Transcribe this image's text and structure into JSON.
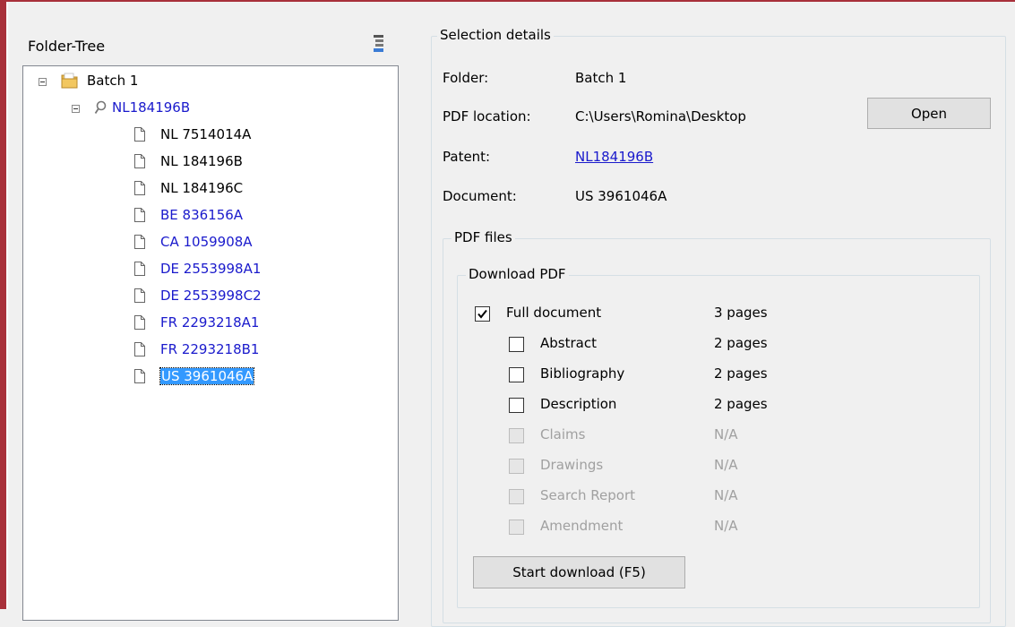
{
  "tree": {
    "title": "Folder-Tree",
    "root": {
      "label": "Batch 1",
      "expanded": true
    },
    "patent": {
      "label": "NL184196B",
      "expanded": true
    },
    "documents": [
      {
        "label": "NL 7514014A",
        "link": false,
        "selected": false
      },
      {
        "label": "NL 184196B",
        "link": false,
        "selected": false
      },
      {
        "label": "NL 184196C",
        "link": false,
        "selected": false
      },
      {
        "label": "BE 836156A",
        "link": true,
        "selected": false
      },
      {
        "label": "CA 1059908A",
        "link": true,
        "selected": false
      },
      {
        "label": "DE 2553998A1",
        "link": true,
        "selected": false
      },
      {
        "label": "DE 2553998C2",
        "link": true,
        "selected": false
      },
      {
        "label": "FR 2293218A1",
        "link": true,
        "selected": false
      },
      {
        "label": "FR 2293218B1",
        "link": true,
        "selected": false
      },
      {
        "label": "US 3961046A",
        "link": true,
        "selected": true
      }
    ]
  },
  "details": {
    "title": "Selection details",
    "folder_label": "Folder:",
    "folder_value": "Batch 1",
    "pdf_location_label": "PDF location:",
    "pdf_location_value": "C:\\Users\\Romina\\Desktop",
    "open_button": "Open",
    "patent_label": "Patent:",
    "patent_value": "NL184196B",
    "document_label": "Document:",
    "document_value": "US 3961046A"
  },
  "pdf_files": {
    "title": "PDF files",
    "download_group_title": "Download PDF",
    "options": [
      {
        "label": "Full document",
        "pages": "3 pages",
        "checked": true,
        "enabled": true
      },
      {
        "label": "Abstract",
        "pages": "2 pages",
        "checked": false,
        "enabled": true
      },
      {
        "label": "Bibliography",
        "pages": "2 pages",
        "checked": false,
        "enabled": true
      },
      {
        "label": "Description",
        "pages": "2 pages",
        "checked": false,
        "enabled": true
      },
      {
        "label": "Claims",
        "pages": "N/A",
        "checked": false,
        "enabled": false
      },
      {
        "label": "Drawings",
        "pages": "N/A",
        "checked": false,
        "enabled": false
      },
      {
        "label": "Search Report",
        "pages": "N/A",
        "checked": false,
        "enabled": false
      },
      {
        "label": "Amendment",
        "pages": "N/A",
        "checked": false,
        "enabled": false
      }
    ],
    "start_button": "Start download (F5)"
  },
  "colors": {
    "frame": "#a8303a",
    "link": "#1a1acc",
    "selection": "#3399ff"
  }
}
